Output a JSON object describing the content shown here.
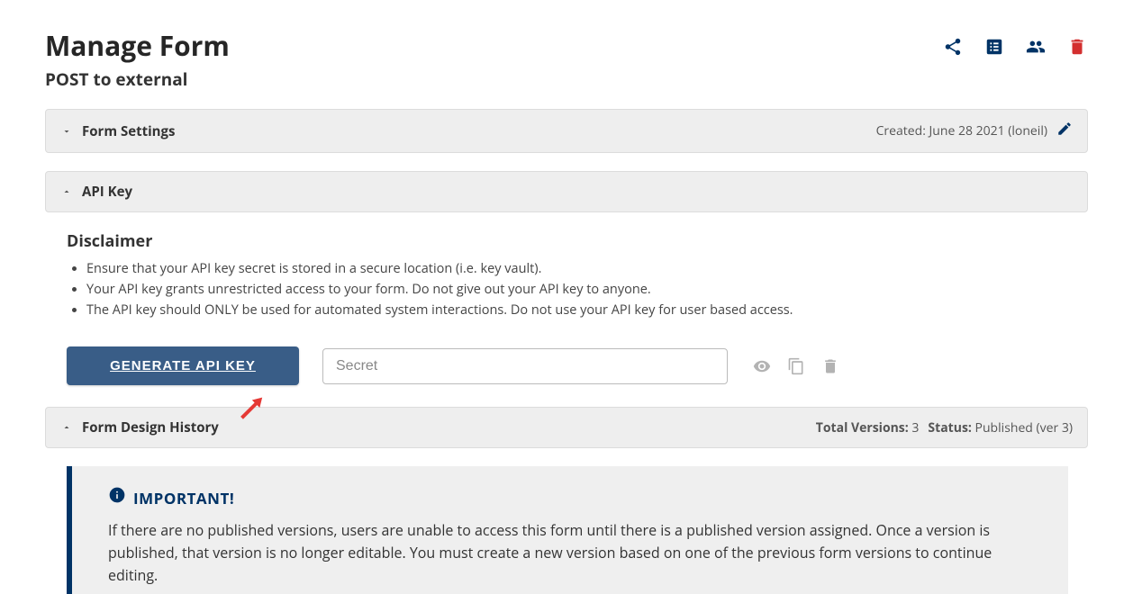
{
  "header": {
    "title": "Manage Form",
    "subtitle": "POST to external"
  },
  "panels": {
    "formSettings": {
      "label": "Form Settings",
      "createdPrefix": "Created:",
      "createdDate": "June 28 2021",
      "createdBy": "(loneil)"
    },
    "apiKey": {
      "label": "API Key",
      "disclaimerTitle": "Disclaimer",
      "bullet1": "Ensure that your API key secret is stored in a secure location (i.e. key vault).",
      "bullet2": "Your API key grants unrestricted access to your form. Do not give out your API key to anyone.",
      "bullet3": "The API key should ONLY be used for automated system interactions. Do not use your API key for user based access.",
      "generateLabel": "GENERATE API KEY",
      "secretPlaceholder": "Secret"
    },
    "history": {
      "label": "Form Design History",
      "versionsLabel": "Total Versions:",
      "versionsValue": "3",
      "statusLabel": "Status:",
      "statusValue": "Published (ver 3)"
    }
  },
  "important": {
    "title": "IMPORTANT!",
    "body": "If there are no published versions, users are unable to access this form until there is a published version assigned. Once a version is published, that version is no longer editable. You must create a new version based on one of the previous form versions to continue editing."
  },
  "colors": {
    "brand": "#003366",
    "primaryButton": "#395d87",
    "danger": "#d32f2f"
  }
}
